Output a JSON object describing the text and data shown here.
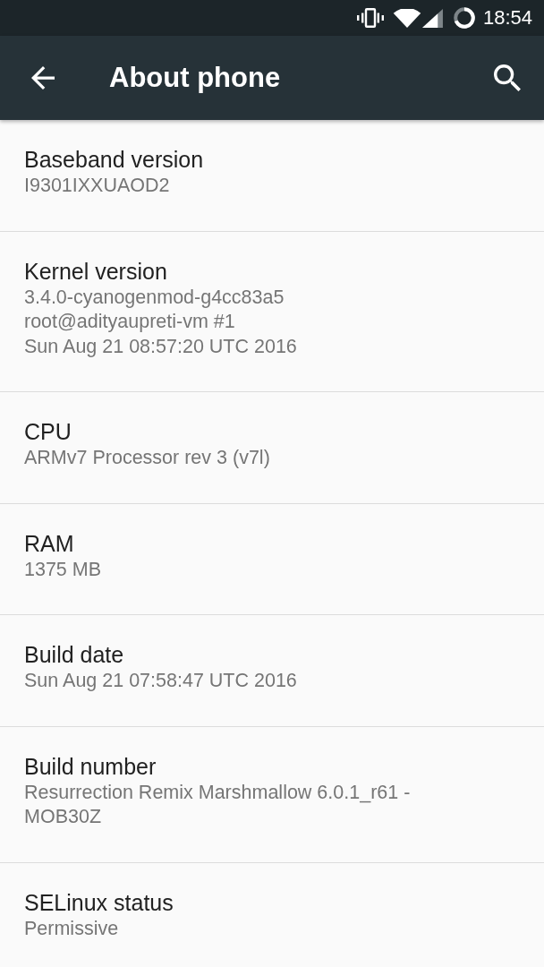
{
  "status_bar": {
    "time": "18:54"
  },
  "toolbar": {
    "title": "About phone"
  },
  "items": [
    {
      "title": "Baseband version",
      "summary": "I9301IXXUAOD2"
    },
    {
      "title": "Kernel version",
      "summary": "3.4.0-cyanogenmod-g4cc83a5\nroot@adityaupreti-vm #1\nSun Aug 21 08:57:20 UTC 2016"
    },
    {
      "title": "CPU",
      "summary": "ARMv7 Processor rev 3 (v7l)"
    },
    {
      "title": "RAM",
      "summary": "1375 MB"
    },
    {
      "title": "Build date",
      "summary": "Sun Aug 21 07:58:47 UTC 2016"
    },
    {
      "title": "Build number",
      "summary": "Resurrection Remix Marshmallow 6.0.1_r61 - MOB30Z"
    },
    {
      "title": "SELinux status",
      "summary": "Permissive"
    }
  ]
}
